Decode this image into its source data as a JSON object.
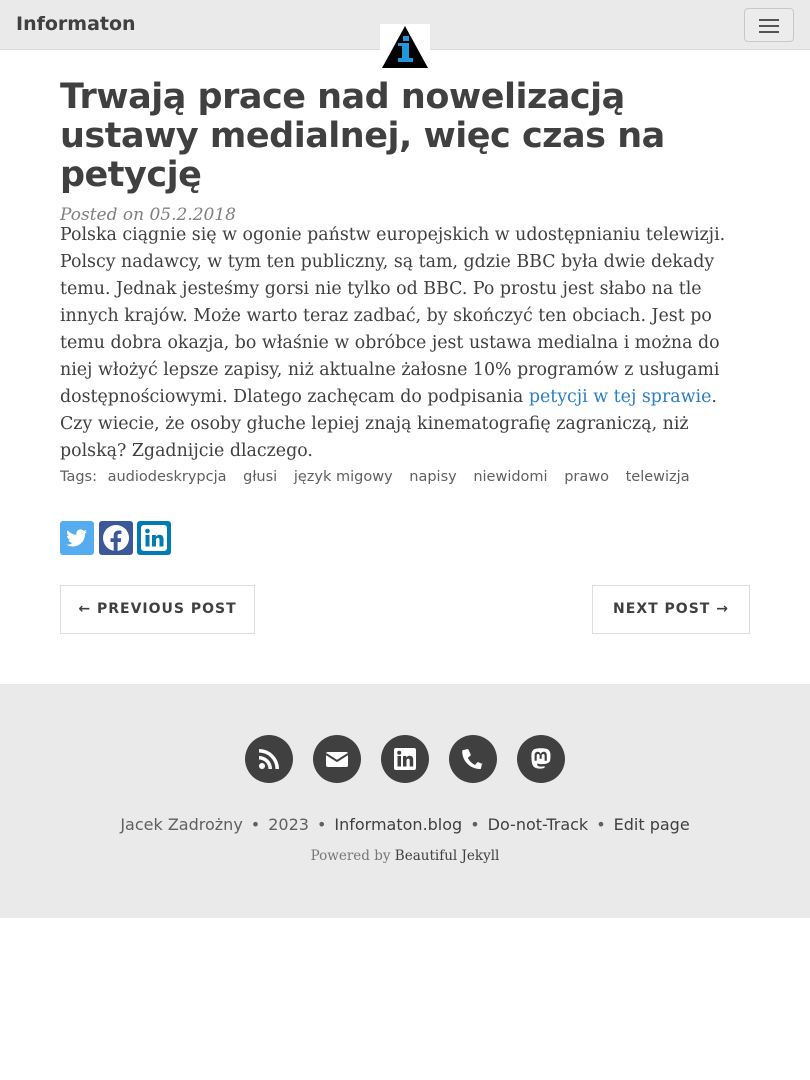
{
  "navbar": {
    "brand": "Informaton"
  },
  "post": {
    "title": "Trwają prace nad nowelizacją ustawy medialnej, więc czas na petycję",
    "meta": "Posted on 05.2.2018",
    "body_before": "Polska ciągnie się w ogonie państw europejskich w udostępnianiu telewizji. Polscy nadawcy, w tym ten publiczny, są tam, gdzie BBC była dwie dekady temu. Jednak jesteśmy gorsi nie tylko od BBC. Po prostu jest słabo na tle innych krajów. Może warto teraz zadbać, by skończyć ten obciach. Jest po temu dobra okazja, bo właśnie w obróbce jest ustawa medialna i można do niej włożyć lepsze zapisy, niż aktualne żałosne 10% programów z usługami dostępnościowymi. Dlatego zachęcam do podpisania ",
    "body_link": "petycji w tej sprawie",
    "body_after": ". Czy wiecie, że osoby głuche lepiej znają kinematografię zagraniczą, niż polską? Zgadnijcie dlaczego.",
    "tags_label": "Tags:",
    "tags": [
      "audiodeskrypcja",
      "głusi",
      "język migowy",
      "napisy",
      "niewidomi",
      "prawo",
      "telewizja"
    ]
  },
  "share": [
    "twitter-icon",
    "facebook-icon",
    "linkedin-icon"
  ],
  "pager": {
    "previous": "← PREVIOUS POST",
    "next": "NEXT POST →"
  },
  "footer": {
    "social": [
      "rss-icon",
      "envelope-icon",
      "linkedin-icon",
      "phone-icon",
      "mastodon-icon"
    ],
    "author": "Jacek Zadrożny",
    "year": "2023",
    "site": "Informaton.blog",
    "dnt": "Do-not-Track",
    "edit": "Edit page",
    "powered_by": "Powered by",
    "theme": "Beautiful Jekyll"
  },
  "colors": {
    "link": "#2a7ec6",
    "twitter": "#55acee",
    "facebook": "#3b5998",
    "linkedin": "#007bb6"
  }
}
